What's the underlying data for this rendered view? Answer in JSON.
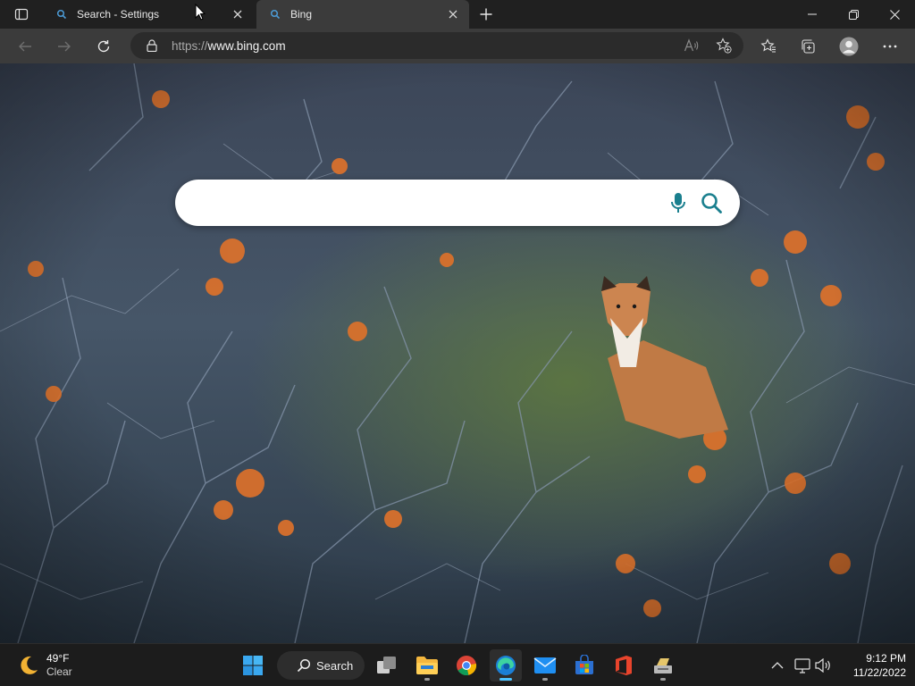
{
  "browser": {
    "tabs": [
      {
        "title": "Search - Settings",
        "active": false
      },
      {
        "title": "Bing",
        "active": true
      }
    ],
    "address_bar": {
      "protocol": "https://",
      "host": "www.bing.com"
    }
  },
  "page": {
    "search": {
      "value": "",
      "placeholder": ""
    },
    "accent_color": "#1a7f8e"
  },
  "taskbar": {
    "weather": {
      "temperature": "49°F",
      "condition": "Clear"
    },
    "search_label": "Search",
    "pinned_apps": [
      {
        "name": "Start",
        "icon": "windows-start-icon"
      },
      {
        "name": "Search",
        "icon": "search-icon"
      },
      {
        "name": "Task View",
        "icon": "task-view-icon"
      },
      {
        "name": "File Explorer",
        "icon": "folder-icon"
      },
      {
        "name": "Google Chrome",
        "icon": "chrome-icon"
      },
      {
        "name": "Microsoft Edge",
        "icon": "edge-icon",
        "active": true
      },
      {
        "name": "Mail",
        "icon": "mail-icon"
      },
      {
        "name": "Microsoft Store",
        "icon": "store-icon"
      },
      {
        "name": "Office",
        "icon": "office-icon"
      },
      {
        "name": "App",
        "icon": "app-icon"
      }
    ],
    "clock": {
      "time": "9:12 PM",
      "date": "11/22/2022"
    }
  }
}
